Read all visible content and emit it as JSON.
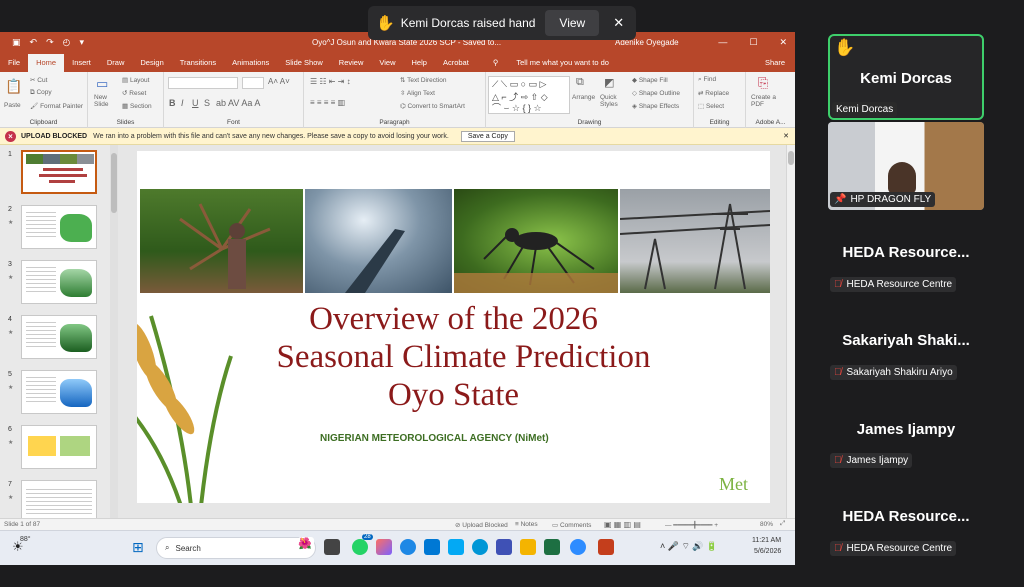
{
  "notification": {
    "text": "Kemi Dorcas raised hand",
    "view_label": "View",
    "close_glyph": "✕"
  },
  "ppt": {
    "title": "Oyo^J Osun and Kwara State 2026 SCP   -   Saved to...",
    "user": "Adenike Oyegade",
    "tabs": [
      "File",
      "Home",
      "Insert",
      "Draw",
      "Design",
      "Transitions",
      "Animations",
      "Slide Show",
      "Review",
      "View",
      "Help",
      "Acrobat"
    ],
    "tell_me": "Tell me what you want to do",
    "share": "Share",
    "ribbon": {
      "clipboard": {
        "paste": "Paste",
        "cut": "Cut",
        "copy": "Copy",
        "format_painter": "Format Painter",
        "label": "Clipboard"
      },
      "slides": {
        "new_slide": "New Slide",
        "layout": "Layout",
        "reset": "Reset",
        "section": "Section",
        "label": "Slides"
      },
      "font": {
        "label": "Font",
        "bold": "B",
        "italic": "I",
        "underline": "U",
        "strike": "S"
      },
      "paragraph": {
        "text_direction": "Text Direction",
        "align_text": "Align Text",
        "smartart": "Convert to SmartArt",
        "label": "Paragraph"
      },
      "drawing": {
        "arrange": "Arrange",
        "quick_styles": "Quick Styles",
        "shape_fill": "Shape Fill",
        "shape_outline": "Shape Outline",
        "shape_effects": "Shape Effects",
        "label": "Drawing"
      },
      "editing": {
        "find": "Find",
        "replace": "Replace",
        "select": "Select",
        "label": "Editing"
      },
      "adobe": {
        "create_pdf": "Create a PDF",
        "label": "Adobe A..."
      }
    },
    "message_bar": {
      "title": "UPLOAD BLOCKED",
      "message": "We ran into a problem with this file and can't save any new changes. Please save a copy to avoid losing your work.",
      "button": "Save a Copy"
    },
    "thumbnails": [
      "1",
      "2",
      "3",
      "4",
      "5",
      "6",
      "7"
    ],
    "slide": {
      "title_lines": [
        "Overview of the 2026",
        "Seasonal Climate Prediction",
        "Oyo State"
      ],
      "agency": "NIGERIAN METEOROLOGICAL AGENCY (NiMet)",
      "logo": "Met"
    },
    "status": {
      "slide_count": "Slide 1 of 87",
      "upload_blocked": "Upload Blocked",
      "notes": "Notes",
      "comments": "Comments",
      "zoom": "80%"
    }
  },
  "taskbar": {
    "weather": "88°",
    "search_placeholder": "Search",
    "time": "11:21 AM",
    "date": "5/6/2026",
    "chat_badge": "28"
  },
  "participants": [
    {
      "name": "Kemi Dorcas",
      "tag": "Kemi Dorcas",
      "hand": "✋"
    },
    {
      "name": "",
      "tag": "HP DRAGON FLY"
    },
    {
      "name": "HEDA  Resource...",
      "tag": "HEDA Resource Centre"
    },
    {
      "name": "Sakariyah  Shaki...",
      "tag": "Sakariyah Shakiru Ariyo"
    },
    {
      "name": "James Ijampy",
      "tag": "James Ijampy"
    },
    {
      "name": "HEDA  Resource...",
      "tag": "HEDA Resource Centre"
    }
  ]
}
